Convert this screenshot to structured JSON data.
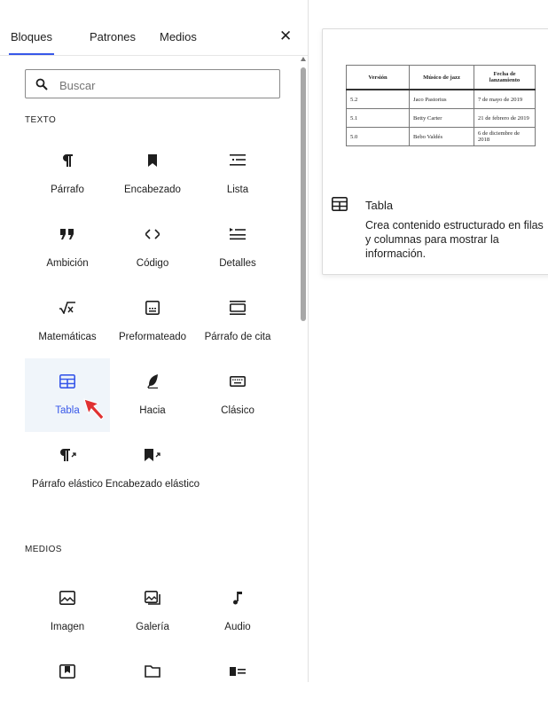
{
  "tabs": [
    "Bloques",
    "Patrones",
    "Medios"
  ],
  "search": {
    "placeholder": "Buscar"
  },
  "sections": {
    "text": "TEXTO",
    "media": "MEDIOS"
  },
  "blocks": {
    "parrafo": "Párrafo",
    "encabezado": "Encabezado",
    "lista": "Lista",
    "ambicion": "Ambición",
    "codigo": "Código",
    "detalles": "Detalles",
    "matematicas": "Matemáticas",
    "preformateado": "Preformateado",
    "parrafo_cita": "Párrafo de cita",
    "tabla": "Tabla",
    "hacia": "Hacia",
    "clasico": "Clásico",
    "parrafo_elastico": "Párrafo elástico",
    "encabezado_elastico": "Encabezado elástico"
  },
  "media": {
    "imagen": "Imagen",
    "galeria": "Galería",
    "audio": "Audio"
  },
  "preview": {
    "table": {
      "headers": [
        "Versión",
        "Músico de jazz",
        "Fecha de lanzamiento"
      ],
      "rows": [
        [
          "5.2",
          "Jaco Pastorius",
          "7 de mayo de 2019"
        ],
        [
          "5.1",
          "Betty Carter",
          "21 de febrero de 2019"
        ],
        [
          "5.0",
          "Bebo Valdés",
          "6 de diciembre de 2018"
        ]
      ]
    },
    "title": "Tabla",
    "description": "Crea contenido estructurado en filas y columnas para mostrar la información."
  },
  "colors": {
    "accent": "#3858e9",
    "selected_bg": "#f0f5fa",
    "cursor": "#e03131"
  }
}
